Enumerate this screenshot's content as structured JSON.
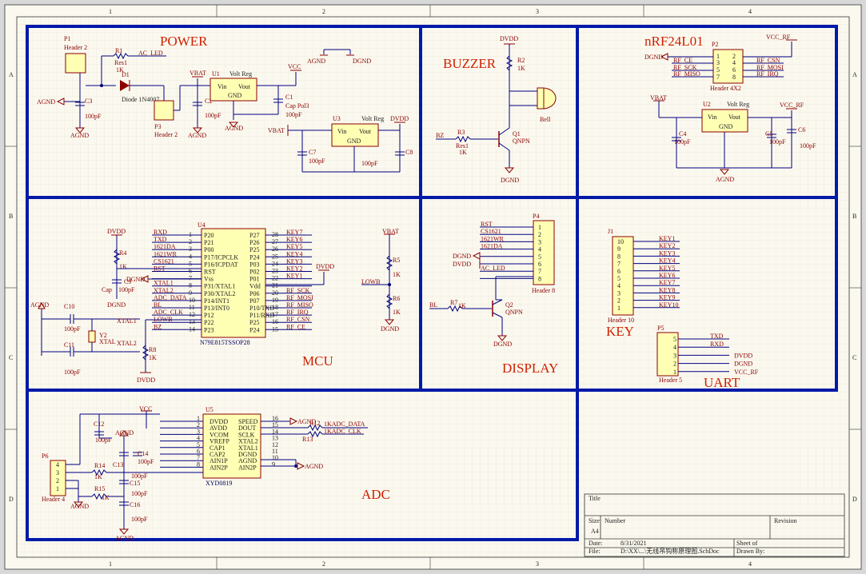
{
  "border": {
    "cols": [
      "1",
      "2",
      "3",
      "4"
    ],
    "rows": [
      "A",
      "B",
      "C",
      "D"
    ]
  },
  "sections": {
    "power": "POWER",
    "buzzer": "BUZZER",
    "nrf": "nRF24L01",
    "mcu": "MCU",
    "display": "DISPLAY",
    "key": "KEY",
    "uart": "UART",
    "adc": "ADC"
  },
  "power": {
    "p1": "P1",
    "p1_name": "Header 2",
    "r1": "R1",
    "r1_name": "Res1",
    "r1_val": "1K",
    "ac_led": "AC_LED",
    "d1": "D1",
    "d1_name": "Diode 1N4007",
    "c3": "C3",
    "c3_val": "100pF",
    "p3": "P3",
    "p3_name": "Header 2",
    "vbat": "VBAT",
    "u1": "U1",
    "u1_name": "Volt Reg",
    "vin": "Vin",
    "vout": "Vout",
    "gnd": "GND",
    "c2": "C2",
    "c2_val": "100pF",
    "vcc": "VCC",
    "c1": "C1",
    "c1_name": "Cap Pol3",
    "c1_val": "100pF",
    "agnd": "AGND",
    "dgnd": "DGND",
    "u3": "U3",
    "u3_name": "Volt Reg",
    "dvdd": "DVDD",
    "c7": "C7",
    "c7_val": "100pF",
    "c8": "C8",
    "c8_val": "100pF"
  },
  "buzzer": {
    "dvdd": "DVDD",
    "r2": "R2",
    "r2_val": "1K",
    "bell": "Bell",
    "bz": "BZ",
    "r3": "R3",
    "r3_name": "Res1",
    "r3_val": "1K",
    "q1": "Q1",
    "q1_name": "QNPN",
    "dgnd": "DGND"
  },
  "nrf": {
    "dgnd": "DGND",
    "p2": "P2",
    "p2_name": "Header 4X2",
    "vcc_rf": "VCC_RF",
    "left": [
      "RF_CE",
      "RF_SCK",
      "RF_MISO"
    ],
    "right": [
      "RF_CSN",
      "RF_MOSI",
      "RF_IRQ"
    ],
    "pins_l": [
      "1",
      "3",
      "5",
      "7"
    ],
    "pins_r": [
      "2",
      "4",
      "6",
      "8"
    ],
    "vbat": "VBAT",
    "u2": "U2",
    "u2_name": "Volt Reg",
    "vin": "Vin",
    "vout": "Vout",
    "gnd": "GND",
    "c4": "C4",
    "c4_val": "100pF",
    "c5": "C5",
    "c5_val": "100pF",
    "c6": "C6",
    "c6_val": "100pF",
    "agnd": "AGND"
  },
  "mcu": {
    "u4": "U4",
    "u4_name": "N79E815TSSOP28",
    "lnet": [
      "RXD",
      "TXD",
      "1621DA",
      "1621WR",
      "CS1621",
      "RST",
      "",
      "XTAL1",
      "XTAL2",
      "ADC_DATA",
      "BL",
      "ADC_CLK",
      "LOWB",
      "BZ"
    ],
    "lnum": [
      "1",
      "2",
      "3",
      "4",
      "5",
      "6",
      "7",
      "8",
      "9",
      "10",
      "11",
      "12",
      "13",
      "14"
    ],
    "lname": [
      "P20",
      "P21",
      "P00",
      "P17/ICPCLK",
      "P16/ICPDAT",
      "RST",
      "Vss",
      "P31/XTAL1",
      "P30/XTAL2",
      "P14/INT1",
      "P13/INT0",
      "P12",
      "P22",
      "P23"
    ],
    "rnet": [
      "KEY7",
      "KEY6",
      "KEY5",
      "KEY4",
      "KEY3",
      "KEY2",
      "KEY1",
      "",
      "RF_SCK",
      "RF_MOSI",
      "RF_MISO",
      "RF_IRQ",
      "RF_CSN",
      "RF_CE"
    ],
    "rnum": [
      "28",
      "27",
      "26",
      "25",
      "24",
      "23",
      "22",
      "21",
      "20",
      "19",
      "18",
      "17",
      "16",
      "15"
    ],
    "rname": [
      "P27",
      "P26",
      "P25",
      "P24",
      "P03",
      "P02",
      "P01",
      "Vdd",
      "P06",
      "P07",
      "P10/TXD",
      "P11/RXD",
      "P25",
      "P24"
    ],
    "dvdd": "DVDD",
    "dgnd": "DGND",
    "agnd": "AGND",
    "r4": "R4",
    "r4_val": "1K",
    "c9": "C9",
    "c9_name": "Cap",
    "c9_val": "100pF",
    "c10": "C10",
    "c10_val": "100pF",
    "c11": "C11",
    "c11_val": "100pF",
    "y2": "Y2",
    "y2_name": "XTAL",
    "xtal1": "XTAL1",
    "xtal2": "XTAL2",
    "r8": "R8",
    "r8_val": "1K",
    "vbat": "VBAT",
    "r5": "R5",
    "r5_val": "1K",
    "r6": "R6",
    "r6_val": "1K",
    "lowb": "LOWB"
  },
  "display": {
    "nets": [
      "RST",
      "CS1621",
      "1621WR",
      "1621DA",
      "",
      "",
      "AC_LED",
      ""
    ],
    "pins": [
      "1",
      "2",
      "3",
      "4",
      "5",
      "6",
      "7",
      "8"
    ],
    "dgnd": "DGND",
    "dvdd": "DVDD",
    "p4": "P4",
    "p4_name": "Header 8",
    "bl": "BL",
    "r7": "R7",
    "r7_val": "1K",
    "q2": "Q2",
    "q2_name": "QNPN"
  },
  "key": {
    "j1": "J1",
    "j1_name": "Header 10",
    "pins": [
      "10",
      "9",
      "8",
      "7",
      "6",
      "5",
      "4",
      "3",
      "2",
      "1"
    ],
    "nets": [
      "KEY1",
      "KEY2",
      "KEY3",
      "KEY4",
      "KEY5",
      "KEY6",
      "KEY7",
      "KEY8",
      "KEY9",
      "KEY10"
    ]
  },
  "uart": {
    "p5": "P5",
    "p5_name": "Header 5",
    "pins": [
      "5",
      "4",
      "3",
      "2",
      "1"
    ],
    "nets": [
      "TXD",
      "RXD",
      "DVDD",
      "DGND",
      "VCC_RF"
    ]
  },
  "adc": {
    "u5": "U5",
    "u5_name": "XYD0819",
    "lname": [
      "DVDD",
      "AVDD",
      "VCOM",
      "VREFP",
      "CAP1",
      "CAP2",
      "AIN1P",
      "AIN2P"
    ],
    "lnum": [
      "1",
      "2",
      "3",
      "4",
      "5",
      "6",
      "7",
      "8"
    ],
    "rname": [
      "SPEED",
      "DOUT",
      "SCLK",
      "XTAL2",
      "XTAL1",
      "DGND",
      "AGND",
      "AIN2P"
    ],
    "rnum": [
      "16",
      "15",
      "14",
      "13",
      "12",
      "11",
      "10",
      "9"
    ],
    "vcc": "VCC",
    "agnd": "AGND",
    "c12": "C12",
    "c12_val": "100pF",
    "c13": "C13",
    "c14": "C14",
    "c14_val": "100pF",
    "c15": "C15",
    "c15_val": "100pF",
    "c16": "C16",
    "c16_val": "100pF",
    "r12": "R12",
    "r13": "R13",
    "kadc_data": "1KADC_DATA",
    "kadc_clk": "1KADC_CLK",
    "r14": "R14",
    "r14_val": "1K",
    "r15": "R15",
    "r15_val": "1K",
    "p6": "P6",
    "p6_name": "Header 4",
    "p6_pins": [
      "4",
      "3",
      "2",
      "1"
    ]
  },
  "titleblock": {
    "title": "Title",
    "size": "Size",
    "size_val": "A4",
    "number": "Number",
    "revision": "Revision",
    "date": "Date:",
    "date_val": "8/31/2021",
    "sheet": "Sheet of",
    "file": "File:",
    "file_val": "D:\\XX\\...\\无线吊钩称原理图.SchDoc",
    "drawn": "Drawn By:"
  }
}
